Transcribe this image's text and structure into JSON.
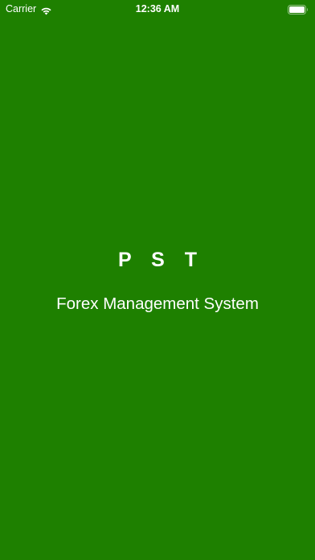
{
  "status_bar": {
    "carrier": "Carrier",
    "time": "12:36 AM",
    "wifi_icon": "wifi-icon",
    "battery_icon": "battery-icon"
  },
  "splash": {
    "title": "P S T",
    "subtitle": "Forex Management System",
    "background_color": "#1e8000",
    "text_color": "#ffffff"
  }
}
